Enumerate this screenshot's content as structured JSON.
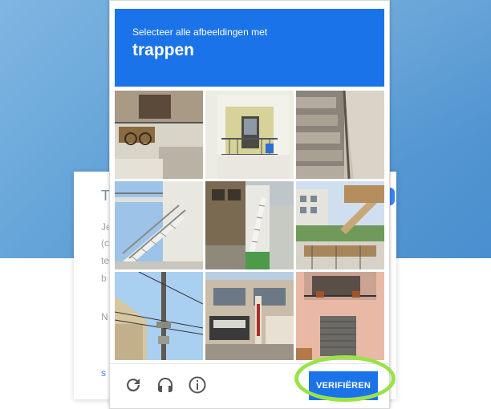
{
  "background": {
    "peek_title": "T",
    "peek_lines": [
      "Je",
      "(c",
      "te",
      "b"
    ],
    "peek_link": "N",
    "peek_footer": "s"
  },
  "captcha": {
    "instruction": "Selecteer alle afbeeldingen met",
    "target_word": "trappen",
    "tiles": [
      {
        "label": "tile-1"
      },
      {
        "label": "tile-2"
      },
      {
        "label": "tile-3"
      },
      {
        "label": "tile-4"
      },
      {
        "label": "tile-5"
      },
      {
        "label": "tile-6"
      },
      {
        "label": "tile-7"
      },
      {
        "label": "tile-8"
      },
      {
        "label": "tile-9"
      }
    ],
    "verify_label": "VERIFIËREN",
    "icons": [
      "reload-icon",
      "headphones-icon",
      "info-icon"
    ],
    "accent": "#1a73e8",
    "highlight_color": "#99e34a"
  }
}
